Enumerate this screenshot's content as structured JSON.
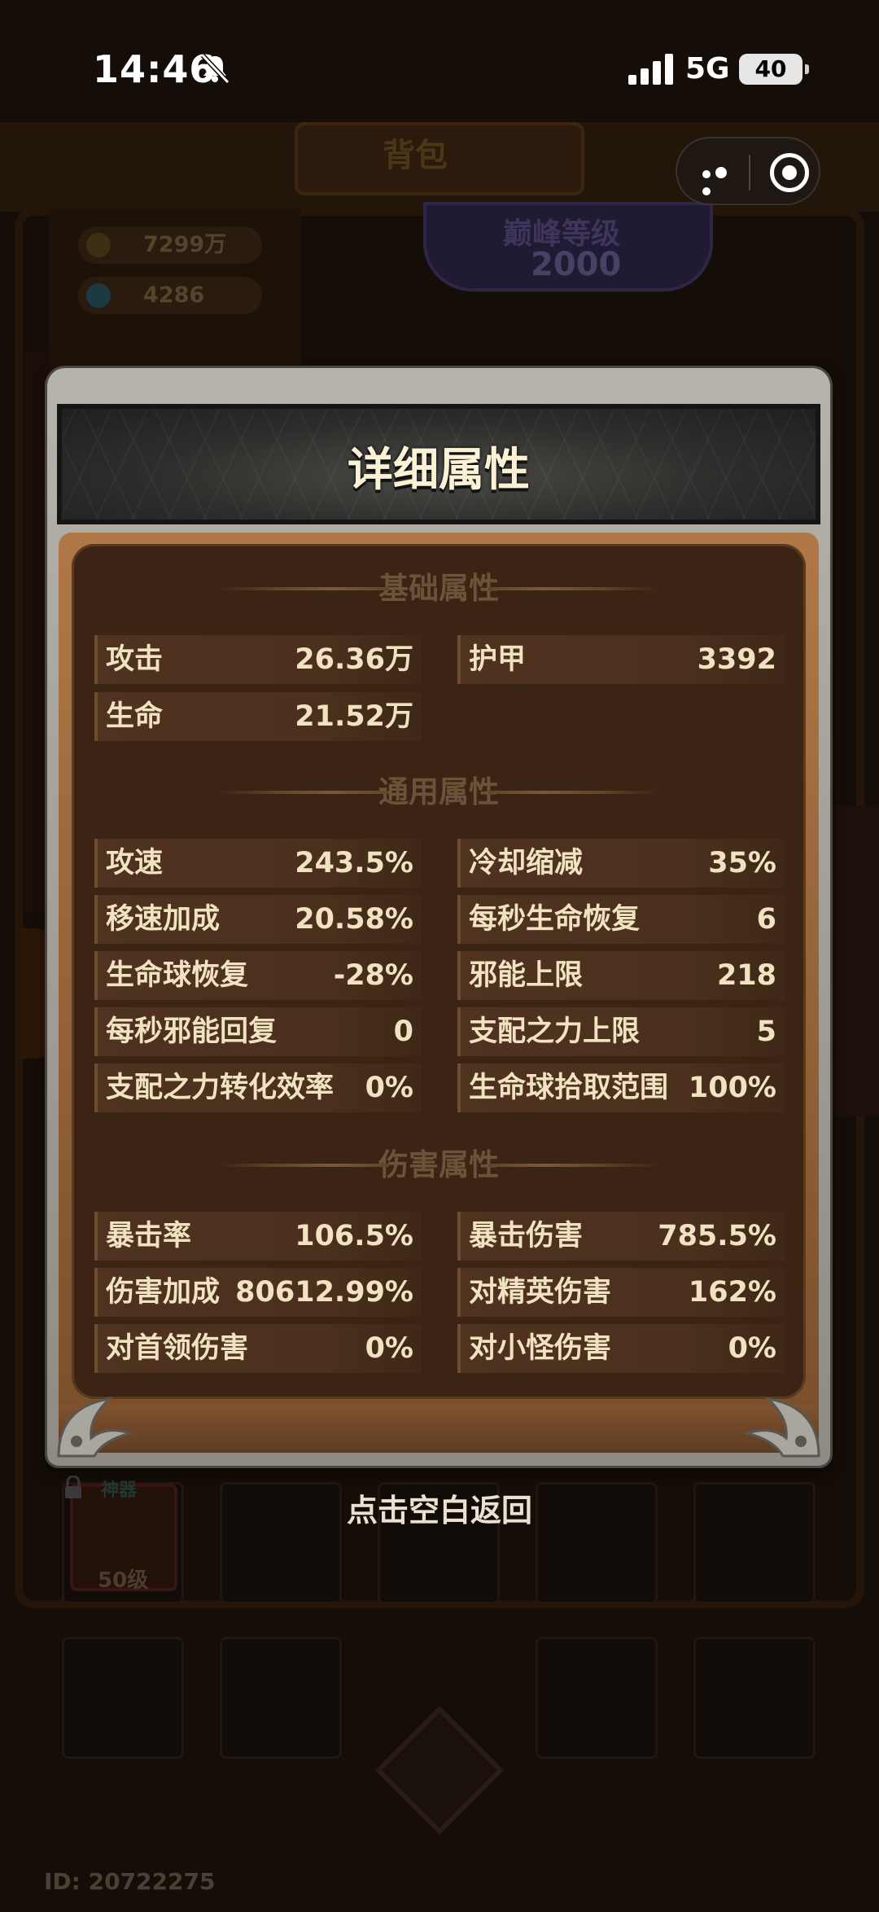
{
  "status_bar": {
    "time": "14:46",
    "network": "5G",
    "battery": "40"
  },
  "background": {
    "header_title": "背包",
    "gold": "7299万",
    "diamonds": "4286",
    "peak_level_label": "巅峰等级",
    "peak_level_value": "2000",
    "item_tag": "神器",
    "item_level": "50级",
    "player_id": "ID: 20722275"
  },
  "modal": {
    "title": "详细属性",
    "sections": [
      {
        "title": "基础属性",
        "stats": [
          {
            "label": "攻击",
            "value": "26.36万"
          },
          {
            "label": "护甲",
            "value": "3392"
          },
          {
            "label": "生命",
            "value": "21.52万"
          }
        ]
      },
      {
        "title": "通用属性",
        "stats": [
          {
            "label": "攻速",
            "value": "243.5%"
          },
          {
            "label": "冷却缩减",
            "value": "35%"
          },
          {
            "label": "移速加成",
            "value": "20.58%"
          },
          {
            "label": "每秒生命恢复",
            "value": "6"
          },
          {
            "label": "生命球恢复",
            "value": "-28%"
          },
          {
            "label": "邪能上限",
            "value": "218"
          },
          {
            "label": "每秒邪能回复",
            "value": "0"
          },
          {
            "label": "支配之力上限",
            "value": "5"
          },
          {
            "label": "支配之力转化效率",
            "value": "0%"
          },
          {
            "label": "生命球拾取范围",
            "value": "100%"
          }
        ]
      },
      {
        "title": "伤害属性",
        "stats": [
          {
            "label": "暴击率",
            "value": "106.5%"
          },
          {
            "label": "暴击伤害",
            "value": "785.5%"
          },
          {
            "label": "伤害加成",
            "value": "80612.99%"
          },
          {
            "label": "对精英伤害",
            "value": "162%"
          },
          {
            "label": "对首领伤害",
            "value": "0%"
          },
          {
            "label": "对小怪伤害",
            "value": "0%"
          }
        ]
      }
    ]
  },
  "dismiss_hint": "点击空白返回",
  "colors": {
    "panel_brown": "#3b2414",
    "row_brown": "#4f3320",
    "text_cream": "#f1e3c2",
    "section_title": "#6a5339"
  }
}
